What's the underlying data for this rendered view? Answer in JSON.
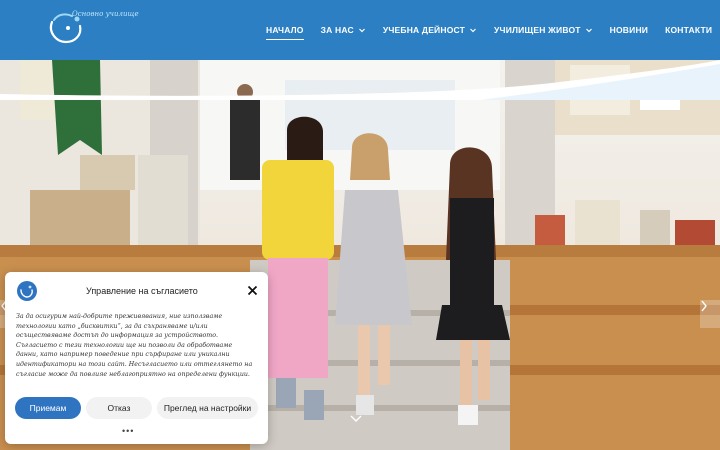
{
  "header": {
    "logo_text": "Основно училище",
    "nav": [
      {
        "label": "НАЧАЛО",
        "active": true,
        "dropdown": false
      },
      {
        "label": "ЗА НАС",
        "active": false,
        "dropdown": true
      },
      {
        "label": "УЧЕБНА ДЕЙНОСТ",
        "active": false,
        "dropdown": true
      },
      {
        "label": "УЧИЛИЩЕН ЖИВОТ",
        "active": false,
        "dropdown": true
      },
      {
        "label": "НОВИНИ",
        "active": false,
        "dropdown": false
      },
      {
        "label": "КОНТАКТИ",
        "active": false,
        "dropdown": false
      }
    ]
  },
  "consent": {
    "title": "Управление на съгласието",
    "text": "За да осигурим най-добрите преживявания, ние използваме технологии като „бисквитки“, за да съхраняваме и/или осъществяваме достъп до информация за устройството. Съгласието с тези технологии ще ни позволи да обработваме данни, като например поведение при сърфиране или уникални идентификатори на този сайт. Несъгласието или оттеглянето на съгласие може да повлияе неблагоприятно на определени функции.",
    "accept_label": "Приемам",
    "reject_label": "Отказ",
    "prefs_label": "Преглед на настройки",
    "more_label": "•••"
  },
  "colors": {
    "header_bg": "#2b7fc2",
    "accent": "#2e74c1"
  }
}
